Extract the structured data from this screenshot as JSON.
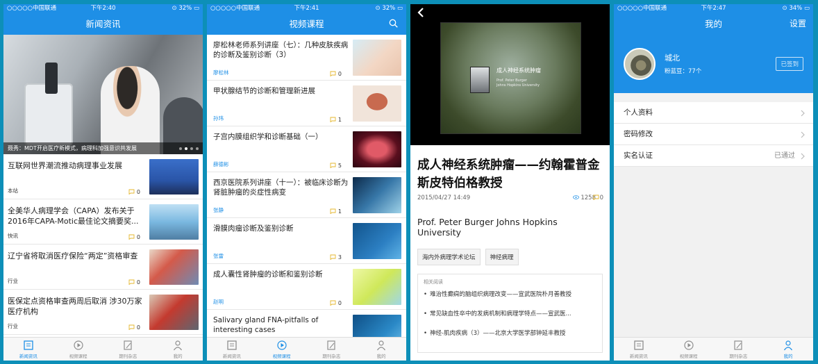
{
  "status": {
    "carrier": "○○○○○中国联通",
    "battery1": "32%",
    "battery3": "34%",
    "time1": "下午2:40",
    "time2": "下午2:41",
    "time4": "下午2:47"
  },
  "tabs": [
    "新闻资讯",
    "视频课程",
    "期刊杂志",
    "我的"
  ],
  "phone1": {
    "title": "新闻资讯",
    "hero_caption": "聂秀：MDT开启医疗新模式，病理科加强意识共发展",
    "items": [
      {
        "title": "互联网世界潮流推动病理事业发展",
        "meta": "本站",
        "count": "0"
      },
      {
        "title": "全美华人病理学会（CAPA）发布关于2016年CAPA-Motic最佳论文摘要奖...",
        "meta": "快讯",
        "count": "0"
      },
      {
        "title": "辽宁省将取消医疗保险“两定”资格审查",
        "meta": "行业",
        "count": "0"
      },
      {
        "title": "医保定点资格审查两周后取消 涉30万家医疗机构",
        "meta": "行业",
        "count": "0"
      }
    ]
  },
  "phone2": {
    "title": "视频课程",
    "items": [
      {
        "title": "廖松林老师系列讲座（七）：几种皮肤疾病的诊断及鉴别诊断（3）",
        "meta": "廖松林",
        "count": "0"
      },
      {
        "title": "甲状腺结节的诊断和管理新进展",
        "meta": "孙玮",
        "count": "1"
      },
      {
        "title": "子宫内膜组织学和诊断基础（一）",
        "meta": "薛德彬",
        "count": "5"
      },
      {
        "title": "西京医院系列讲座（十一）：被临床诊断为肾脏肿瘤的炎症性病变",
        "meta": "张静",
        "count": "1"
      },
      {
        "title": "滑膜肉瘤诊断及鉴别诊断",
        "meta": "张雷",
        "count": "3"
      },
      {
        "title": "成人囊性肾肿瘤的诊断和鉴别诊断",
        "meta": "赵明",
        "count": "0"
      },
      {
        "title": "Salivary gland FNA-pitfalls of interesting cases",
        "meta": "",
        "count": ""
      }
    ]
  },
  "phone3": {
    "slide_title": "成人神经系统肿瘤",
    "slide_sub1": "Prof. Peter Burger",
    "slide_sub2": "Johns Hopkins University",
    "title": "成人神经系统肿瘤——约翰霍普金斯皮特伯格教授",
    "date": "2015/04/27 14:49",
    "views": "1258",
    "comments": "0",
    "body": "Prof. Peter Burger  Johns Hopkins University",
    "tags": [
      "海内外病理学术论坛",
      "神经病理"
    ],
    "related_head": "相关阅读",
    "related": [
      "难治性癫痫的脑组织病理改变——宣武医院朴月善教授",
      "常见缺血性卒中的发病机制和病理学特点——宣武医...",
      "神经-肌肉疾病（3）——北京大学医学部钟延丰教授"
    ]
  },
  "phone4": {
    "title": "我的",
    "settings": "设置",
    "name": "城北",
    "beans": "粉蓝豆：77个",
    "checkin": "已签到",
    "menu": [
      {
        "label": "个人资料",
        "value": ""
      },
      {
        "label": "密码修改",
        "value": ""
      },
      {
        "label": "实名认证",
        "value": "已通过"
      }
    ]
  },
  "colors": {
    "brand": "#1e8fe6"
  }
}
